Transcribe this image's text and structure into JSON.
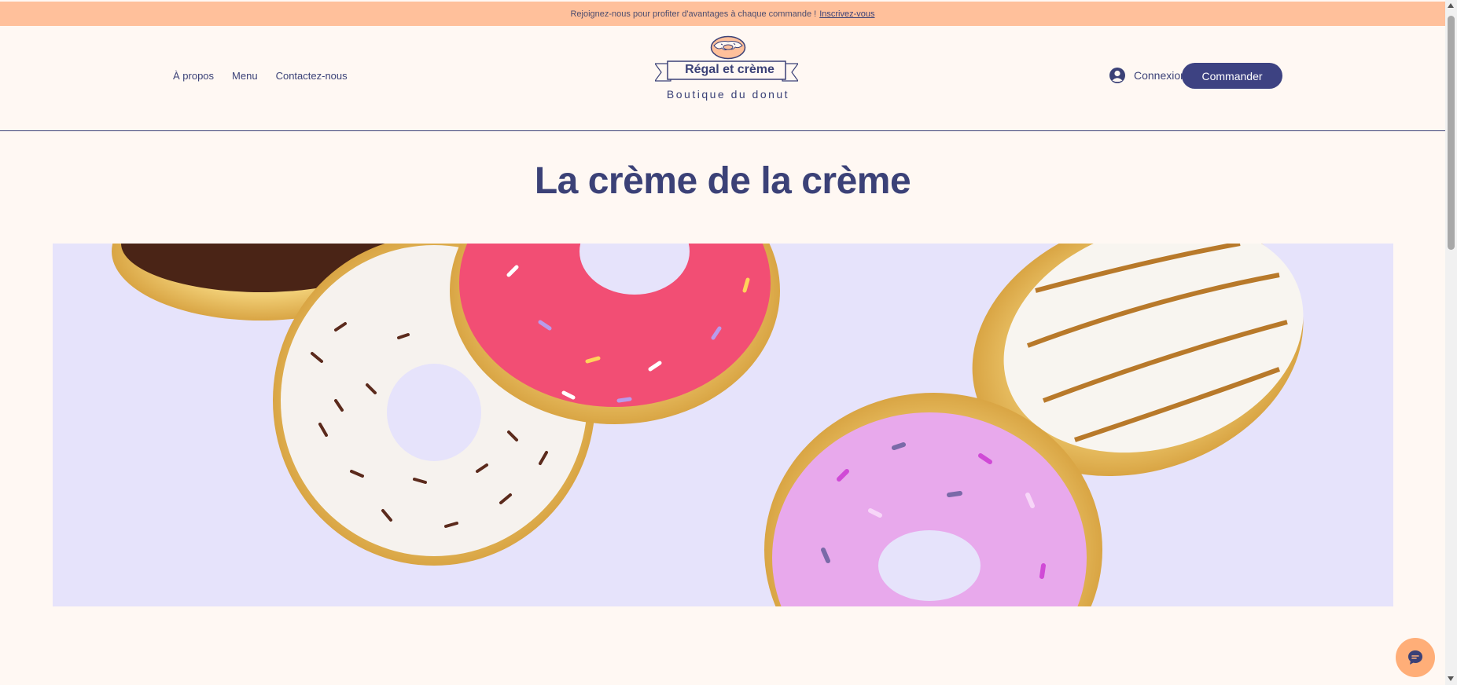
{
  "announcement": {
    "text": "Rejoignez-nous pour profiter d'avantages à chaque commande !",
    "link": "Inscrivez-vous"
  },
  "nav": {
    "items": [
      {
        "label": "À propos"
      },
      {
        "label": "Menu"
      },
      {
        "label": "Contactez-nous"
      }
    ]
  },
  "logo": {
    "name": "Régal et crème",
    "subtitle": "Boutique du donut"
  },
  "header": {
    "login_label": "Connexion",
    "order_button": "Commander"
  },
  "hero": {
    "title": "La crème de la crème"
  },
  "colors": {
    "background": "#FFF8F3",
    "announcement_bar": "#FFC09B",
    "brand_navy": "#3B4177",
    "button": "#3D4282",
    "hero_bg": "#E6E3FB",
    "chat": "#FFAE78"
  },
  "icons": {
    "login": "user-circle-icon",
    "chat": "chat-bubble-icon",
    "logo": "donut-logo-icon"
  }
}
